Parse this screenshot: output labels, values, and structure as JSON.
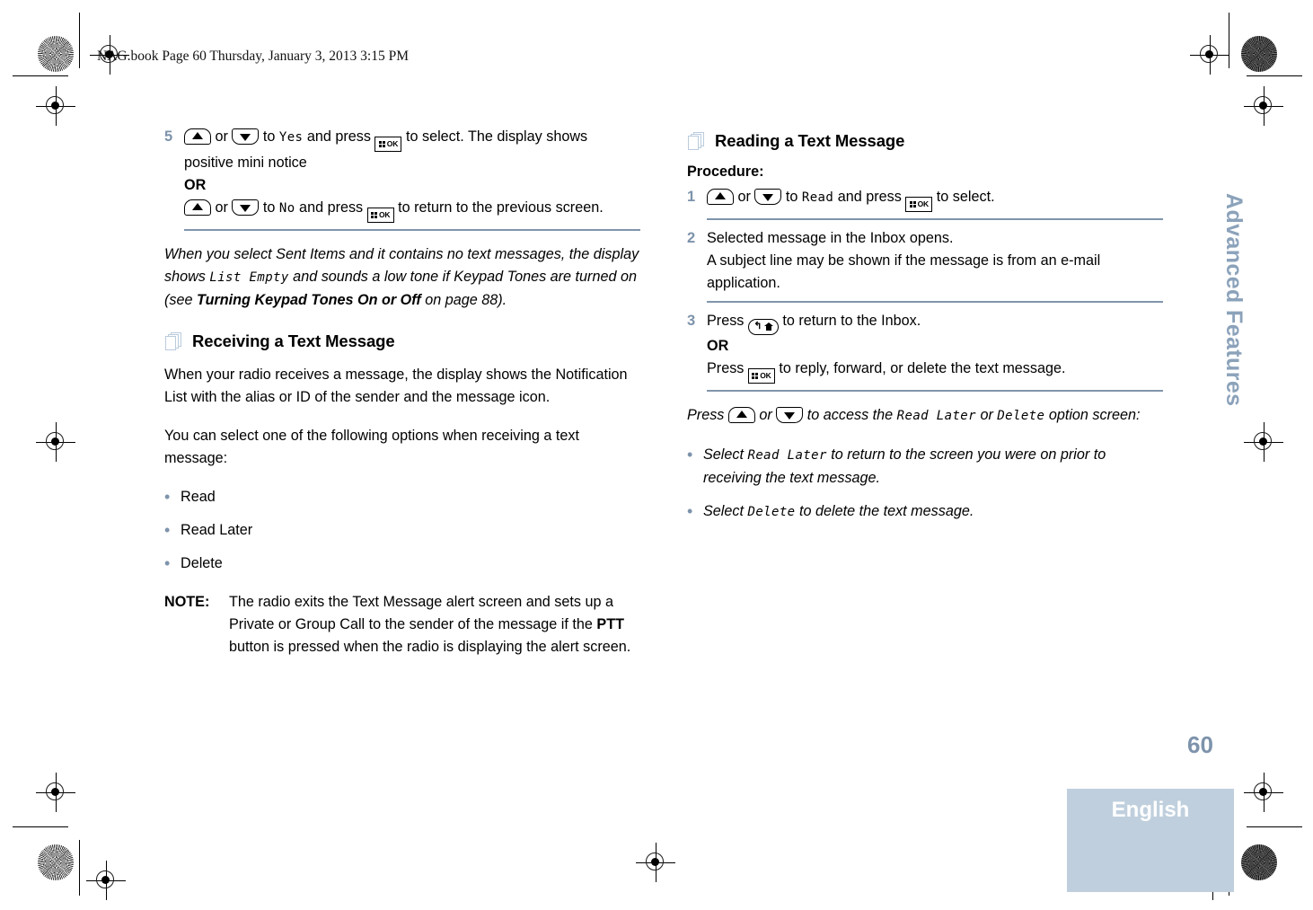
{
  "filestamp": "NAG.book  Page 60  Thursday, January 3, 2013  3:15 PM",
  "sidebar": {
    "tab_label": "Advanced Features"
  },
  "footer": {
    "page_number": "60",
    "language": "English"
  },
  "colors": {
    "accent_blue_gray": "#7d93ab",
    "rule": "#8095ab",
    "footer_band": "#bfcfdd",
    "icon_outline": "#b9cbdd"
  },
  "left_column": {
    "step5": {
      "number": "5",
      "t1": " or ",
      "t2": " to ",
      "lcd_yes": "Yes",
      "t3": " and press ",
      "t4": " to select. The display shows positive mini notice",
      "or_label": "OR",
      "t5": " or ",
      "t6": " to ",
      "lcd_no": "No",
      "t7": " and press ",
      "t8": " to return to the previous screen."
    },
    "note_paragraph": {
      "p1": "When you select Sent Items and it contains no text messages, the display shows ",
      "lcd": "List Empty",
      "p2": " and sounds a low tone if Keypad Tones are turned on (see ",
      "bold": "Turning Keypad Tones On or Off",
      "p3": " on page 88)."
    },
    "section": {
      "icon": "pages-icon",
      "title": "Receiving a Text Message",
      "para1": "When your radio receives a message, the display shows the Notification List with the alias or ID of the sender and the message icon.",
      "para2": "You can select one of the following options when receiving a text message:",
      "options": [
        "Read",
        "Read Later",
        "Delete"
      ]
    },
    "note_block": {
      "label": "NOTE:",
      "b1": "The radio exits the Text Message alert screen and sets up a Private or Group Call to the sender of the message if the ",
      "bold": "PTT",
      "b2": " button is pressed when the radio is displaying the alert screen."
    }
  },
  "right_column": {
    "section": {
      "icon": "pages-icon",
      "title": "Reading a Text Message",
      "procedure_label": "Procedure:"
    },
    "step1": {
      "number": "1",
      "t1": " or ",
      "t2": " to ",
      "lcd_read": "Read",
      "t3": " and press ",
      "t4": " to select."
    },
    "step2": {
      "number": "2",
      "line1": "Selected message in the Inbox opens.",
      "line2": "A subject line may be shown if the message is from an e-mail application."
    },
    "step3": {
      "number": "3",
      "t1": "Press ",
      "t2": " to return to the Inbox.",
      "or_label": "OR",
      "t3": "Press ",
      "t4": " to reply, forward, or delete the text message."
    },
    "closing": {
      "p1": "Press ",
      "p2": " or ",
      "p3": " to access the ",
      "lcd_read_later": "Read Later",
      "p4": " or ",
      "lcd_delete": "Delete",
      "p5": " option screen:"
    },
    "bullets": [
      {
        "b1": "Select ",
        "lcd": "Read Later",
        "b2": " to return to the screen you were on prior to receiving the text message."
      },
      {
        "b1": "Select ",
        "lcd": "Delete",
        "b2": " to delete the text message."
      }
    ]
  }
}
